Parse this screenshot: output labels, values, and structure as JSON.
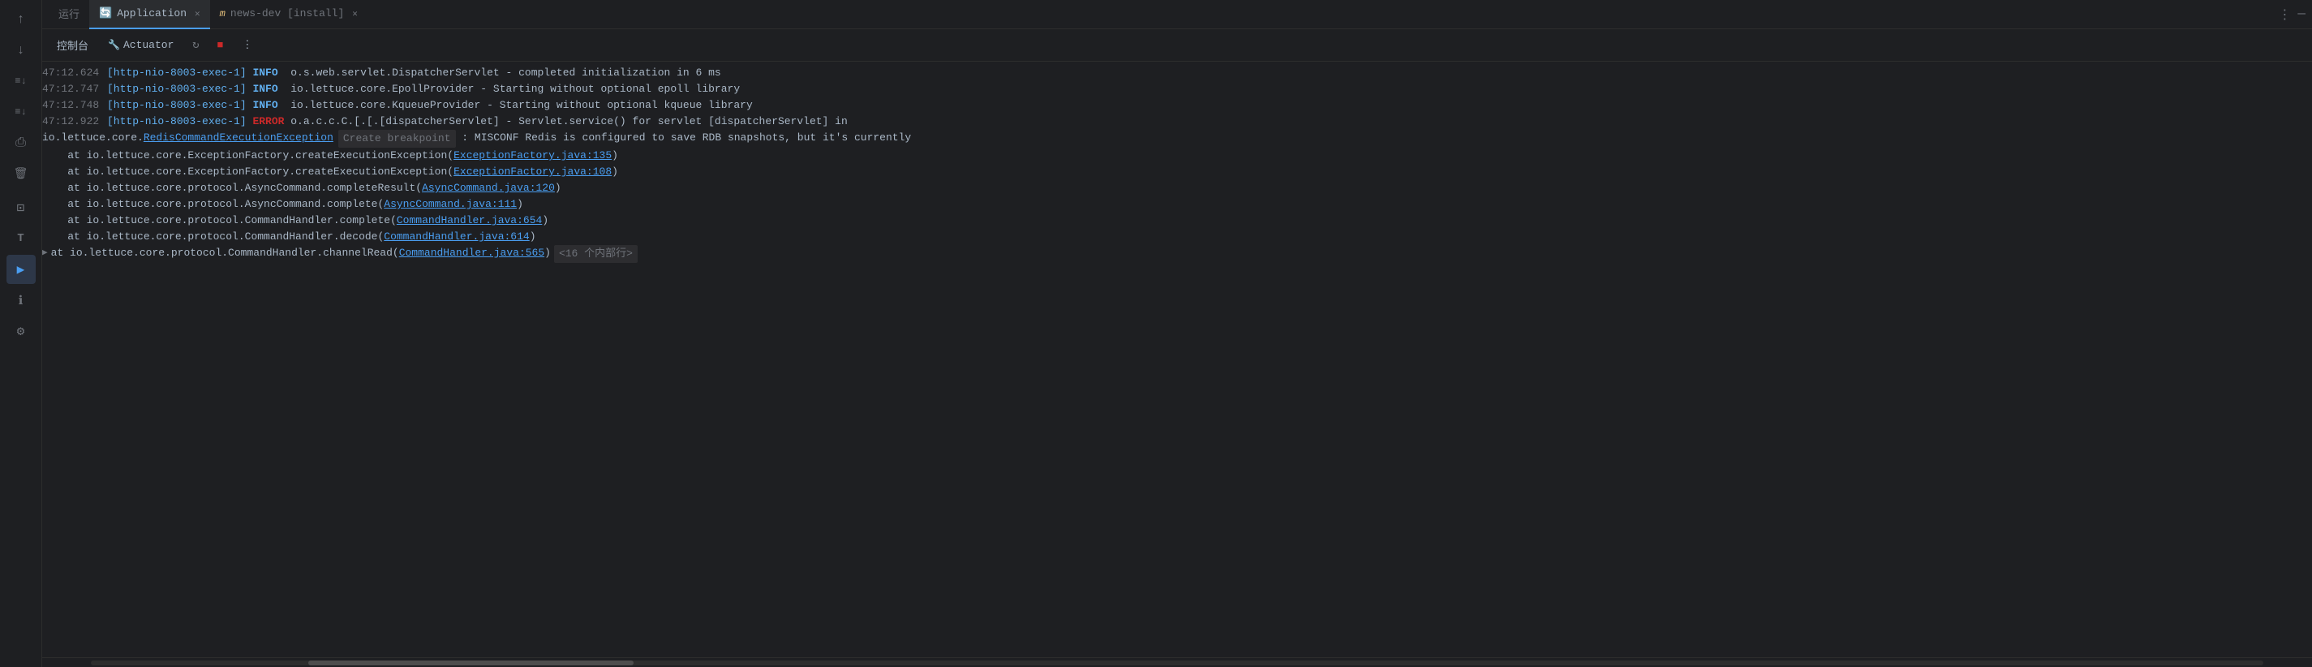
{
  "tabs": [
    {
      "id": "run",
      "label": "运行",
      "icon": "",
      "active": false,
      "closable": false
    },
    {
      "id": "application",
      "label": "Application",
      "icon": "🔄",
      "active": true,
      "closable": true
    },
    {
      "id": "news-dev",
      "label": "news-dev [install]",
      "icon": "m",
      "active": false,
      "closable": true
    }
  ],
  "toolbar": {
    "console_label": "控制台",
    "actuator_label": "Actuator",
    "more_label": "⋮"
  },
  "log_lines": [
    {
      "id": 1,
      "timestamp": "47:12.624",
      "thread": "[http-nio-8003-exec-1]",
      "level": "INFO",
      "class": "o.s.web.servlet.DispatcherServlet",
      "separator": "-",
      "message": " completed initialization in 6 ms"
    },
    {
      "id": 2,
      "timestamp": "47:12.747",
      "thread": "[http-nio-8003-exec-1]",
      "level": "INFO",
      "class": "io.lettuce.core.EpollProvider",
      "separator": "-",
      "message": " Starting without optional epoll library"
    },
    {
      "id": 3,
      "timestamp": "47:12.748",
      "thread": "[http-nio-8003-exec-1]",
      "level": "INFO",
      "class": "io.lettuce.core.KqueueProvider",
      "separator": "-",
      "message": " Starting without optional kqueue library"
    },
    {
      "id": 4,
      "timestamp": "47:12.922",
      "thread": "[http-nio-8003-exec-1]",
      "level": "ERROR",
      "class": "o.a.c.c.C.[.[.[dispatcherServlet]",
      "separator": "-",
      "message": " Servlet.service() for servlet [dispatcherServlet] in"
    },
    {
      "id": 5,
      "type": "exception",
      "prefix": "io.lettuce.core.",
      "link_text": "RedisCommandExecutionException",
      "tooltip": "Create breakpoint",
      "message": " : MISCONF Redis is configured to save RDB snapshots, but it's currently"
    },
    {
      "id": 6,
      "type": "stack",
      "indent": "    ",
      "prefix": "at io.lettuce.core.ExceptionFactory.createExecutionException(",
      "link_text": "ExceptionFactory.java:135",
      "suffix": ")"
    },
    {
      "id": 7,
      "type": "stack",
      "indent": "    ",
      "prefix": "at io.lettuce.core.ExceptionFactory.createExecutionException(",
      "link_text": "ExceptionFactory.java:108",
      "suffix": ")"
    },
    {
      "id": 8,
      "type": "stack",
      "indent": "    ",
      "prefix": "at io.lettuce.core.protocol.AsyncCommand.completeResult(",
      "link_text": "AsyncCommand.java:120",
      "suffix": ")"
    },
    {
      "id": 9,
      "type": "stack",
      "indent": "    ",
      "prefix": "at io.lettuce.core.protocol.AsyncCommand.complete(",
      "link_text": "AsyncCommand.java:111",
      "suffix": ")"
    },
    {
      "id": 10,
      "type": "stack",
      "indent": "    ",
      "prefix": "at io.lettuce.core.protocol.CommandHandler.complete(",
      "link_text": "CommandHandler.java:654",
      "suffix": ")"
    },
    {
      "id": 11,
      "type": "stack",
      "indent": "    ",
      "prefix": "at io.lettuce.core.protocol.CommandHandler.decode(",
      "link_text": "CommandHandler.java:614",
      "suffix": ")"
    },
    {
      "id": 12,
      "type": "stack_expand",
      "indent": "    ",
      "prefix": "at io.lettuce.core.protocol.CommandHandler.channelRead(",
      "link_text": "CommandHandler.java:565",
      "suffix": ")",
      "internal_count": "<16 个内部行>"
    }
  ],
  "gutter_icons": {
    "up_arrow": "↑",
    "down_arrow": "↓",
    "filter": "≡↓",
    "filter2": "≡↓",
    "print": "⎙",
    "delete": "🗑",
    "terminal": "⊡",
    "tools": "T",
    "run_debug": "▶",
    "info": "ℹ",
    "settings": "⚙"
  },
  "colors": {
    "background": "#1e1f22",
    "active_tab_bg": "#2b2d30",
    "border": "#2d2d2d",
    "timestamp": "#6f737a",
    "thread": "#61afef",
    "info_level": "#61afef",
    "error_level": "#cc2929",
    "class_name": "#e5c07b",
    "link": "#4a9ef1",
    "message": "#a9b7c6",
    "accent": "#4a9ef1"
  }
}
